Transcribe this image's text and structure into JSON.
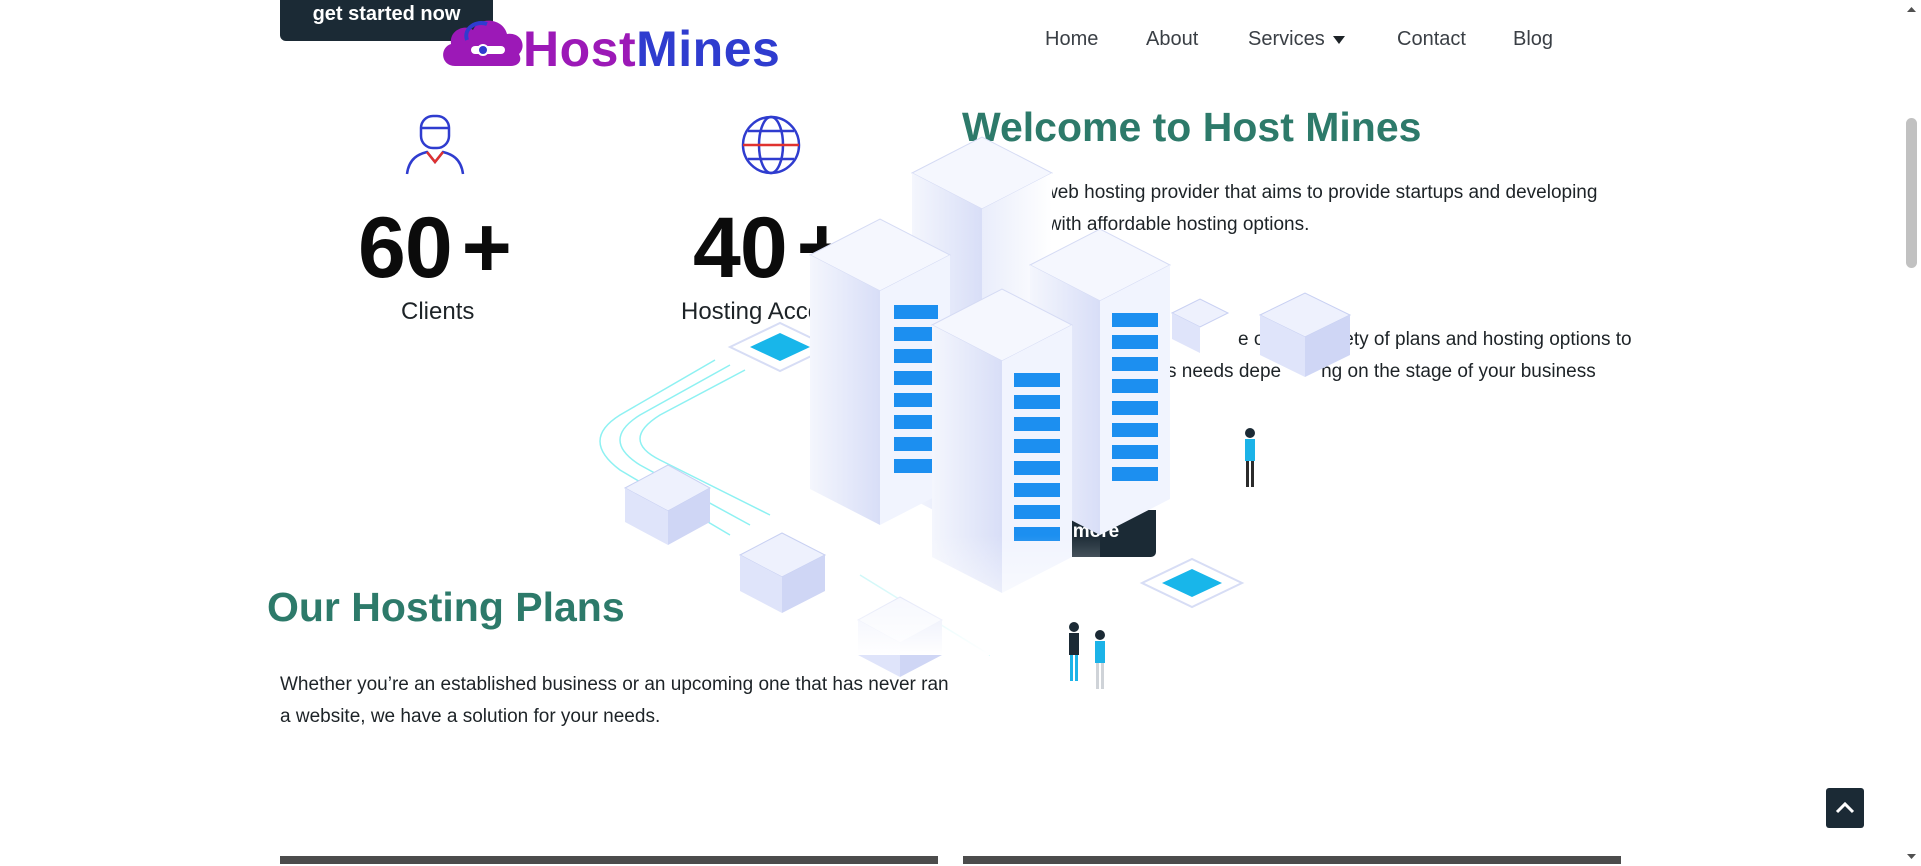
{
  "header": {
    "cta_label": "get started now",
    "logo": {
      "part1": "Host",
      "part2": "Mines"
    },
    "nav": [
      {
        "label": "Home"
      },
      {
        "label": "About"
      },
      {
        "label": "Services"
      },
      {
        "label": "Contact"
      },
      {
        "label": "Blog"
      }
    ]
  },
  "stats": [
    {
      "value": "60",
      "suffix": "+",
      "label": "Clients",
      "icon": "user-icon"
    },
    {
      "value": "40",
      "suffix": "+",
      "label": "Hosting Acco",
      "icon": "globe-icon"
    }
  ],
  "welcome": {
    "title": "Welcome to Host Mines",
    "para1_line1": "web hosting provider that aims to provide startups and developing",
    "para1_line2": "s with affordable hosting options.",
    "para2_line1": "e offer a variety of plans and hosting options to",
    "para2_line2": "s needs depe",
    "para2_line2b": "ng on the stage of your business",
    "learn_more_label": "more"
  },
  "plans": {
    "title": "Our Hosting Plans",
    "description": "Whether you’re an established business or an upcoming one that has never ran a website, we have a solution for your needs."
  },
  "colors": {
    "accent_teal": "#2d7a6a",
    "dark_button": "#1b2a35",
    "logo_purple": "#9c19b7",
    "logo_blue": "#2f3ccf"
  },
  "icons": {
    "scroll_top": "chevron-up-icon",
    "services_caret": "caret-down-icon"
  }
}
